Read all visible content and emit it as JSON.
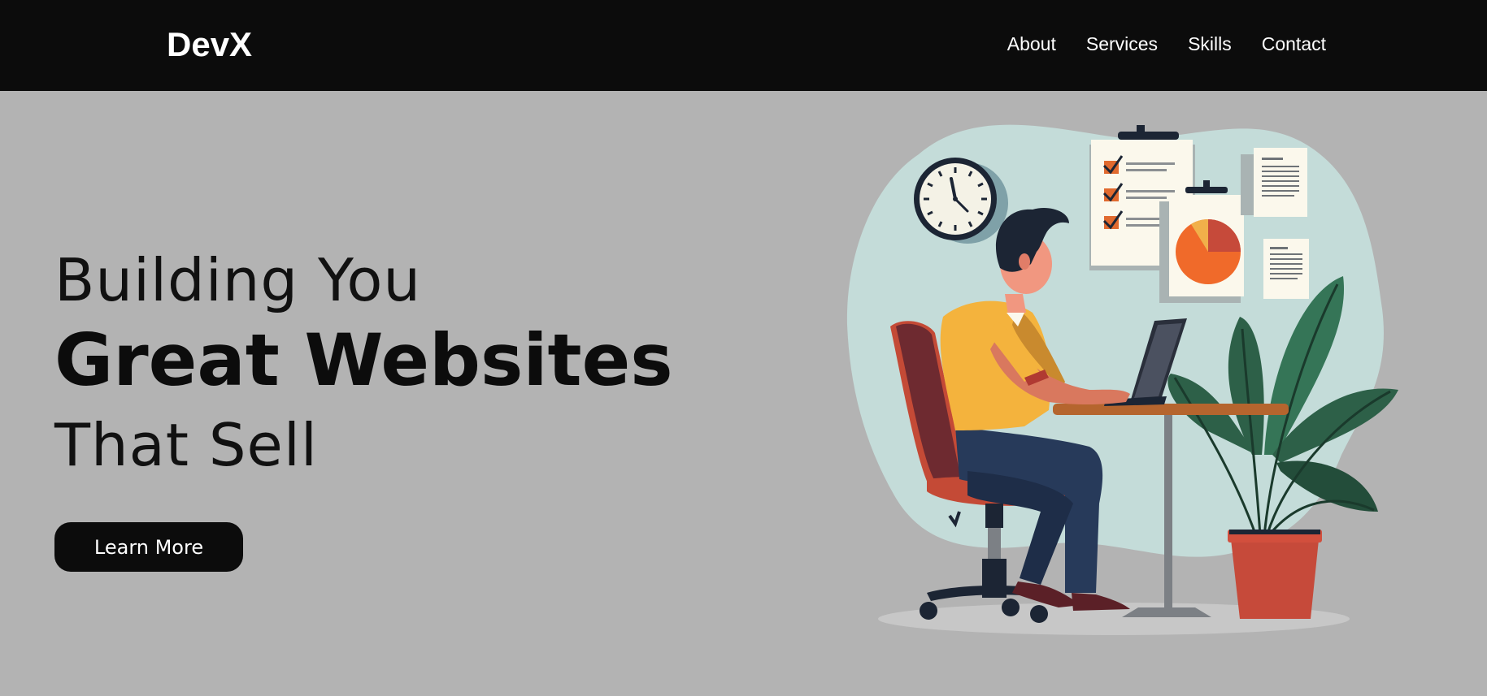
{
  "nav": {
    "logo": "DevX",
    "links": [
      "About",
      "Services",
      "Skills",
      "Contact"
    ]
  },
  "hero": {
    "line1": "Building You",
    "line2": "Great Websites",
    "line3": "That Sell",
    "cta_label": "Learn More"
  },
  "colors": {
    "nav_bg": "#0c0c0c",
    "page_bg": "#b3b3b3",
    "button_bg": "#0c0c0c",
    "text_dark": "#111111"
  },
  "illustration": {
    "icons": [
      "clock-icon",
      "checklist-icon",
      "pie-chart-icon",
      "document-icon",
      "plant-icon",
      "laptop-icon",
      "chair-icon"
    ]
  }
}
